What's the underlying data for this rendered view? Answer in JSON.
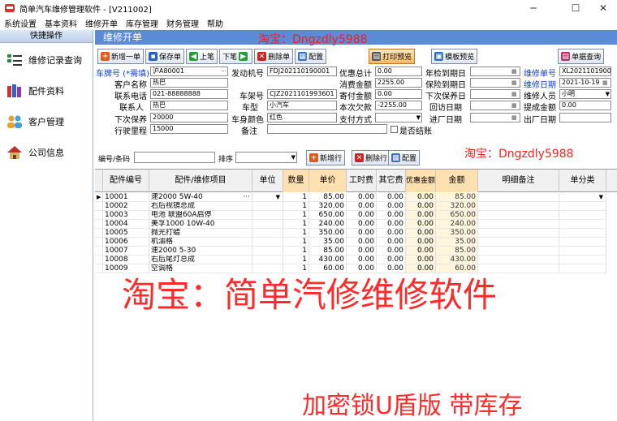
{
  "window": {
    "title": "简单汽车维修管理软件 - [V211002]",
    "minimize": "─",
    "maximize": "☐",
    "close": "✕"
  },
  "menu": [
    "系统设置",
    "基本资料",
    "维修开单",
    "库存管理",
    "财务管理",
    "帮助"
  ],
  "sidebar": {
    "header": "快捷操作",
    "items": [
      {
        "label": "维修记录查询",
        "icon": "checklist-icon"
      },
      {
        "label": "配件资料",
        "icon": "books-icon"
      },
      {
        "label": "客户管理",
        "icon": "users-icon"
      },
      {
        "label": "公司信息",
        "icon": "house-icon"
      }
    ]
  },
  "main": {
    "header": "维修开单",
    "watermark_top": "淘宝：Dngzdly5988"
  },
  "toolbar": {
    "new": "新增一单",
    "save": "保存单",
    "prev": "上笔",
    "next": "下笔",
    "delete": "删除单",
    "config": "配置",
    "print": "打印预览",
    "template": "模板预览",
    "query": "单据查询"
  },
  "form": {
    "plate_label": "车牌号 (*需填)",
    "plate_value": "沪A80001",
    "plate_btn": "···",
    "engine_label": "发动机号",
    "engine_value": "FDJ202110190001",
    "discount_total_label": "优惠总计",
    "discount_total_value": "0.00",
    "annual_due_label": "年检到期日",
    "order_no_label": "维修单号",
    "order_no_value": "XL20211019001",
    "customer_label": "客户名称",
    "customer_value": "热巴",
    "consume_label": "消费金额",
    "consume_value": "2255.00",
    "insurance_due_label": "保险到期日",
    "order_date_label": "维修日期",
    "order_date_value": "2021-10-19",
    "phone_label": "联系电话",
    "phone_value": "021-88888888",
    "vin_label": "车架号",
    "vin_value": "CJZ2021101993601",
    "deposit_label": "寄付金额",
    "deposit_value": "0.00",
    "next_maint_label": "下次保养日",
    "staff_label": "维修人员",
    "staff_value": "小明",
    "contact_label": "联系人",
    "contact_value": "热巴",
    "model_label": "车型",
    "model_value": "小汽车",
    "owed_label": "本次欠款",
    "owed_value": "-2255.00",
    "revisit_label": "回访日期",
    "bonus_label": "提成金额",
    "bonus_value": "0.00",
    "next_service_label": "下次保养",
    "next_service_value": "20000",
    "color_label": "车身颜色",
    "color_value": "红色",
    "pay_label": "支付方式",
    "pay_value": "",
    "entry_label": "进厂日期",
    "exit_label": "出厂日期",
    "mileage_label": "行驶里程",
    "mileage_value": "15000",
    "remark_label": "备注",
    "remark_value": "",
    "settled_label": "是否结账"
  },
  "detail": {
    "code_label": "编号/条码",
    "sort_label": "排序",
    "add_row": "新增行",
    "del_row": "删除行",
    "config": "配置",
    "watermark": "淘宝：Dngzdly5988"
  },
  "grid": {
    "headers": [
      "配件编号",
      "配件/维修项目",
      "单位",
      "数量",
      "单价",
      "工时费",
      "其它费",
      "优惠金额",
      "金额",
      "明细备注",
      "单分类"
    ],
    "rows": [
      {
        "code": "10001",
        "item": "速2000 5W-40",
        "unit": "",
        "qty": "1",
        "price": "85.00",
        "labor": "0.00",
        "other": "0.00",
        "disc": "0.00",
        "amount": "85.00"
      },
      {
        "code": "10002",
        "item": "右后视镜总成",
        "unit": "",
        "qty": "1",
        "price": "320.00",
        "labor": "0.00",
        "other": "0.00",
        "disc": "0.00",
        "amount": "320.00"
      },
      {
        "code": "10003",
        "item": "电池 联盟60A启停",
        "unit": "",
        "qty": "1",
        "price": "650.00",
        "labor": "0.00",
        "other": "0.00",
        "disc": "0.00",
        "amount": "650.00"
      },
      {
        "code": "10004",
        "item": "美孚1000 10W-40",
        "unit": "",
        "qty": "1",
        "price": "240.00",
        "labor": "0.00",
        "other": "0.00",
        "disc": "0.00",
        "amount": "240.00"
      },
      {
        "code": "10005",
        "item": "抛光打蜡",
        "unit": "",
        "qty": "1",
        "price": "350.00",
        "labor": "0.00",
        "other": "0.00",
        "disc": "0.00",
        "amount": "350.00"
      },
      {
        "code": "10006",
        "item": "机油格",
        "unit": "",
        "qty": "1",
        "price": "35.00",
        "labor": "0.00",
        "other": "0.00",
        "disc": "0.00",
        "amount": "35.00"
      },
      {
        "code": "10007",
        "item": "速2000 5-30",
        "unit": "",
        "qty": "1",
        "price": "85.00",
        "labor": "0.00",
        "other": "0.00",
        "disc": "0.00",
        "amount": "85.00"
      },
      {
        "code": "10008",
        "item": "右后尾灯总成",
        "unit": "",
        "qty": "1",
        "price": "430.00",
        "labor": "0.00",
        "other": "0.00",
        "disc": "0.00",
        "amount": "430.00"
      },
      {
        "code": "10009",
        "item": "空调格",
        "unit": "",
        "qty": "1",
        "price": "60.00",
        "labor": "0.00",
        "other": "0.00",
        "disc": "0.00",
        "amount": "60.00"
      }
    ]
  },
  "watermarks": {
    "big": "淘宝：简单汽修维修软件",
    "bottom": "加密锁U盾版 带库存"
  },
  "colors": {
    "accent": "#5b8ad6",
    "watermark": "#ff2a2a",
    "amount_bg": "#fff4dc",
    "disc_bg": "#fff4dc"
  }
}
